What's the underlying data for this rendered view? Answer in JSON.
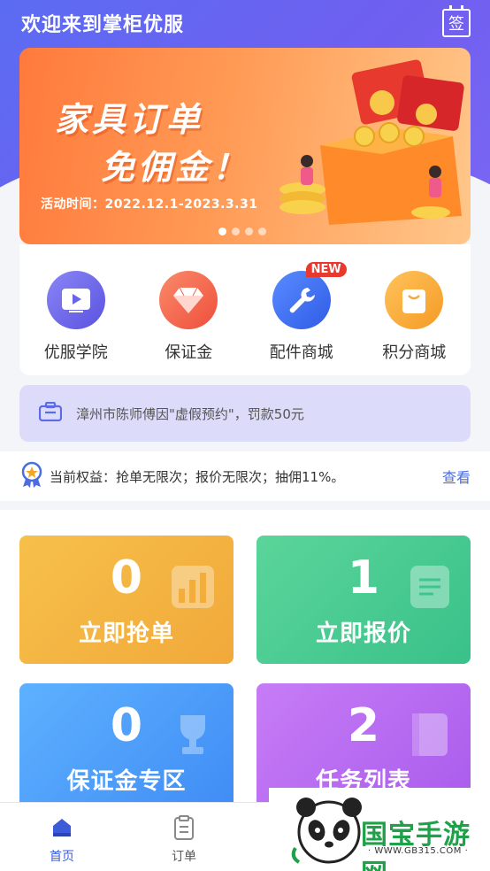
{
  "header": {
    "title": "欢迎来到掌柜优服",
    "sign_label": "签"
  },
  "banner": {
    "title_line1": "家具订单",
    "title_line2": "免佣金！",
    "date_text": "活动时间：2022.12.1-2023.3.31",
    "slide_count": 4,
    "active_slide": 1
  },
  "quick_menu": [
    {
      "label": "优服学院",
      "icon": "video-book-icon",
      "color": "#6a64e8"
    },
    {
      "label": "保证金",
      "icon": "diamond-icon",
      "color": "#f2644f"
    },
    {
      "label": "配件商城",
      "icon": "wrench-icon",
      "color": "#3e6ef0",
      "badge": "NEW"
    },
    {
      "label": "积分商城",
      "icon": "bag-icon",
      "color": "#f6a93b"
    }
  ],
  "notice": {
    "text": "漳州市陈师傅因\"虚假预约\"，罚款50元",
    "icon": "briefcase-icon"
  },
  "rights": {
    "text": "当前权益：抢单无限次；报价无限次；抽佣11%。",
    "link": "查看",
    "icon": "medal-icon"
  },
  "cards": [
    {
      "value": "0",
      "label": "立即抢单",
      "color": "#f4b443",
      "icon": "chart-icon"
    },
    {
      "value": "1",
      "label": "立即报价",
      "color": "#4ccc92",
      "icon": "document-icon"
    },
    {
      "value": "0",
      "label": "保证金专区",
      "color": "#4d9efa",
      "icon": "trophy-icon"
    },
    {
      "value": "2",
      "label": "任务列表",
      "color": "#b66cf1",
      "icon": "book-icon"
    }
  ],
  "tabbar": [
    {
      "label": "首页",
      "icon": "home-icon",
      "active": true
    },
    {
      "label": "订单",
      "icon": "clipboard-icon",
      "active": false
    }
  ],
  "watermark": {
    "text": "国宝手游网",
    "url": "· WWW.GB315.COM ·"
  }
}
